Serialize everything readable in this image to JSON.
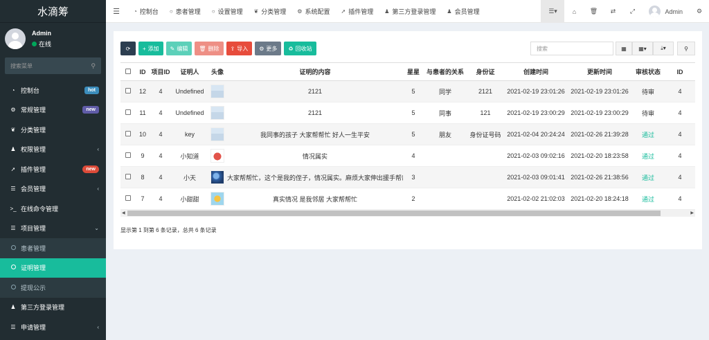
{
  "app": {
    "logo": "水滴筹"
  },
  "user": {
    "name": "Admin",
    "status": "在线"
  },
  "sidebar": {
    "search_placeholder": "搜索菜单",
    "items": [
      {
        "label": "控制台",
        "icon": "dashboard-icon",
        "glyph": "◔",
        "badge": "hot"
      },
      {
        "label": "常规管理",
        "icon": "gears-icon",
        "glyph": "⚙",
        "badge": "new"
      },
      {
        "label": "分类管理",
        "icon": "leaf-icon",
        "glyph": "❦"
      },
      {
        "label": "权限管理",
        "icon": "group-icon",
        "glyph": "♟",
        "chevron": "‹"
      },
      {
        "label": "插件管理",
        "icon": "rocket-icon",
        "glyph": "➚",
        "badge": "new"
      },
      {
        "label": "会员管理",
        "icon": "list-icon",
        "glyph": "☰",
        "chevron": "‹"
      },
      {
        "label": "在线命令管理",
        "icon": "terminal-icon",
        "glyph": ">_"
      },
      {
        "label": "项目管理",
        "icon": "list-icon",
        "glyph": "☰",
        "chevron": "⌄"
      },
      {
        "label": "患者管理",
        "icon": "circle-icon"
      },
      {
        "label": "证明管理",
        "icon": "circle-icon"
      },
      {
        "label": "提现公示",
        "icon": "circle-icon"
      },
      {
        "label": "第三方登录管理",
        "icon": "group-icon",
        "glyph": "♟"
      },
      {
        "label": "申请管理",
        "icon": "list-icon",
        "glyph": "☰",
        "chevron": "‹"
      }
    ]
  },
  "topbar": {
    "tabs": [
      {
        "label": "控制台",
        "icon": "dashboard-icon",
        "glyph": "◔"
      },
      {
        "label": "患者管理",
        "icon": "circle-icon",
        "glyph": "○"
      },
      {
        "label": "设置管理",
        "icon": "circle-icon",
        "glyph": "○"
      },
      {
        "label": "分类管理",
        "icon": "leaf-icon",
        "glyph": "❦"
      },
      {
        "label": "系统配置",
        "icon": "cog-icon",
        "glyph": "⚙"
      },
      {
        "label": "插件管理",
        "icon": "rocket-icon",
        "glyph": "➚"
      },
      {
        "label": "第三方登录管理",
        "icon": "group-icon",
        "glyph": "♟"
      },
      {
        "label": "会员管理",
        "icon": "user-icon",
        "glyph": "♟"
      }
    ],
    "admin_name": "Admin"
  },
  "toolbar": {
    "add": "添加",
    "edit": "编辑",
    "delete": "删除",
    "import": "导入",
    "more": "更多",
    "recycle": "回收站",
    "search_placeholder": "搜索"
  },
  "table": {
    "columns": [
      "ID",
      "项目ID",
      "证明人",
      "头像",
      "证明的内容",
      "星星",
      "与患者的关系",
      "身份证",
      "创建时间",
      "更新时间",
      "审核状态",
      "ID"
    ],
    "rows": [
      {
        "id": "12",
        "project_id": "4",
        "witness": "Undefined",
        "avatar": "cloud",
        "content": "2121",
        "stars": "5",
        "relation": "同学",
        "idcard": "2121",
        "created": "2021-02-19 23:01:26",
        "updated": "2021-02-19 23:01:26",
        "status": "待审",
        "status_type": "pending",
        "id2": "4"
      },
      {
        "id": "11",
        "project_id": "4",
        "witness": "Undefined",
        "avatar": "cloud",
        "content": "2121",
        "stars": "5",
        "relation": "同事",
        "idcard": "121",
        "created": "2021-02-19 23:00:29",
        "updated": "2021-02-19 23:00:29",
        "status": "待审",
        "status_type": "pending",
        "id2": "4"
      },
      {
        "id": "10",
        "project_id": "4",
        "witness": "key",
        "avatar": "cloud",
        "content": "我同事的孩子 大家帮帮忙 好人一生平安",
        "stars": "5",
        "relation": "朋友",
        "idcard": "身份证号码",
        "created": "2021-02-04 20:24:24",
        "updated": "2021-02-26 21:39:28",
        "status": "通过",
        "status_type": "pass",
        "id2": "4"
      },
      {
        "id": "9",
        "project_id": "4",
        "witness": "小知道",
        "avatar": "fruit",
        "content": "情况属实",
        "stars": "4",
        "relation": "",
        "idcard": "",
        "created": "2021-02-03 09:02:16",
        "updated": "2021-02-20 18:23:58",
        "status": "通过",
        "status_type": "pass",
        "id2": "4"
      },
      {
        "id": "8",
        "project_id": "4",
        "witness": "小天",
        "avatar": "blue",
        "content": "大家帮帮忙，这个是我的侄子，情况属实。麻烦大家伸出援手帮帮她",
        "stars": "3",
        "relation": "",
        "idcard": "",
        "created": "2021-02-03 09:01:41",
        "updated": "2021-02-26 21:38:56",
        "status": "通过",
        "status_type": "pass",
        "id2": "4"
      },
      {
        "id": "7",
        "project_id": "4",
        "witness": "小甜甜",
        "avatar": "sun",
        "content": "真实情况 是我邻居 大家帮帮忙",
        "stars": "2",
        "relation": "",
        "idcard": "",
        "created": "2021-02-02 21:02:03",
        "updated": "2021-02-20 18:24:18",
        "status": "通过",
        "status_type": "pass",
        "id2": "4"
      }
    ]
  },
  "pagination": {
    "summary": "显示第 1 到第 6 条记录，总共 6 条记录"
  },
  "colors": {
    "sidebar_bg": "#222d32",
    "accent": "#18bc9c",
    "danger": "#e74c3c"
  }
}
